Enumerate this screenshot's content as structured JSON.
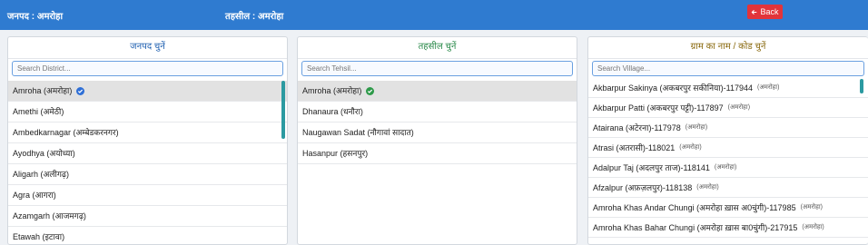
{
  "header": {
    "district_crumb": "जनपद : अमरोहा",
    "tehsil_crumb": "तहसील : अमरोहा",
    "back_label": "Back",
    "back_icon": "arrow-left-icon"
  },
  "colors": {
    "header_bg": "#2f7bd0",
    "back_bg": "#e2343a",
    "district_title": "#1e5fb0",
    "tehsil_title": "#2a8a4a",
    "village_title": "#8a6a10",
    "scroll": "#2b9aa1",
    "check_blue": "#2f6fd6",
    "check_green": "#2e9a4a"
  },
  "district_panel": {
    "title": "जनपद चुनें",
    "search_placeholder": "Search District...",
    "items": [
      {
        "label": "Amroha (अमरोहा)",
        "selected": true
      },
      {
        "label": "Amethi (अमेठी)"
      },
      {
        "label": "Ambedkarnagar (अम्बेडकरनगर)"
      },
      {
        "label": "Ayodhya (अयोध्या)"
      },
      {
        "label": "Aligarh (अलीगढ़)"
      },
      {
        "label": "Agra (आगरा)"
      },
      {
        "label": "Azamgarh (आजमगढ़)"
      },
      {
        "label": "Etawah (इटावा)"
      }
    ]
  },
  "tehsil_panel": {
    "title": "तहसील चुनें",
    "search_placeholder": "Search Tehsil...",
    "items": [
      {
        "label": "Amroha (अमरोहा)",
        "selected": true
      },
      {
        "label": "Dhanaura (धनौरा)"
      },
      {
        "label": "Naugawan Sadat (नौगावां सादात)"
      },
      {
        "label": "Hasanpur (हसनपुर)"
      }
    ]
  },
  "village_panel": {
    "title": "ग्राम का नाम / कोड चुनें",
    "search_placeholder": "Search Village...",
    "items": [
      {
        "label": "Akbarpur Sakinya (अकबरपुर सकीनिया)-117944",
        "sub": "(अमरोहा)"
      },
      {
        "label": "Akbarpur Patti (अकबरपुर पट्टी)-117897",
        "sub": "(अमरोहा)"
      },
      {
        "label": "Atairana (अटेरना)-117978",
        "sub": "(अमरोहा)"
      },
      {
        "label": "Atrasi (अतरासी)-118021",
        "sub": "(अमरोहा)"
      },
      {
        "label": "Adalpur Taj (अदलपुर ताज)-118141",
        "sub": "(अमरोहा)"
      },
      {
        "label": "Afzalpur (अफ़ज़लपुर)-118138",
        "sub": "(अमरोहा)"
      },
      {
        "label": "Amroha Khas Andar Chungi (अमरोहा ख़ास अ0चुंगी)-117985",
        "sub": "(अमरोहा)"
      },
      {
        "label": "Amroha Khas Bahar Chungi (अमरोहा ख़ास बा0चुंगी)-217915",
        "sub": "(अमरोहा)"
      }
    ]
  }
}
